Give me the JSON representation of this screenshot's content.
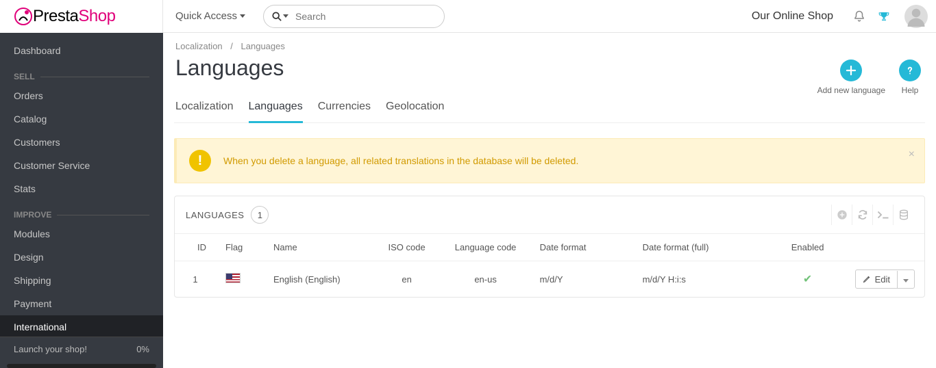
{
  "header": {
    "logo": {
      "presta": "Presta",
      "shop": "Shop"
    },
    "quick_access": "Quick Access",
    "search_placeholder": "Search",
    "shop_name": "Our Online Shop"
  },
  "sidebar": {
    "dashboard": "Dashboard",
    "sections": [
      {
        "title": "SELL",
        "items": [
          "Orders",
          "Catalog",
          "Customers",
          "Customer Service",
          "Stats"
        ]
      },
      {
        "title": "IMPROVE",
        "items": [
          "Modules",
          "Design",
          "Shipping",
          "Payment",
          "International"
        ]
      }
    ],
    "active": "International",
    "launch": {
      "label": "Launch your shop!",
      "pct": "0%"
    }
  },
  "breadcrumb": {
    "parent": "Localization",
    "current": "Languages"
  },
  "page_title": "Languages",
  "actions": {
    "add": "Add new language",
    "help": "Help"
  },
  "tabs": [
    "Localization",
    "Languages",
    "Currencies",
    "Geolocation"
  ],
  "active_tab": "Languages",
  "alert": "When you delete a language, all related translations in the database will be deleted.",
  "panel": {
    "title": "LANGUAGES",
    "count": "1",
    "columns": [
      "ID",
      "Flag",
      "Name",
      "ISO code",
      "Language code",
      "Date format",
      "Date format (full)",
      "Enabled"
    ],
    "rows": [
      {
        "id": "1",
        "name": "English (English)",
        "iso": "en",
        "lang": "en-us",
        "date_fmt": "m/d/Y",
        "date_fmt_full": "m/d/Y H:i:s",
        "enabled": true
      }
    ],
    "edit_label": "Edit"
  }
}
